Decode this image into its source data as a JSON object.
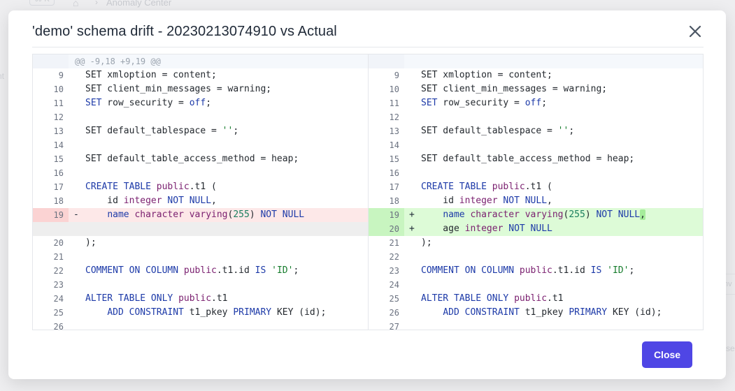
{
  "background": {
    "tag": "⌘ K",
    "breadcrumb": "Anomaly Center",
    "side_text": "nt",
    "right_box_text": "nv",
    "right_text": "se"
  },
  "modal": {
    "title": "'demo' schema drift - 20230213074910 vs Actual",
    "close_label": "Close",
    "hunk_header": "@@ -9,18 +9,19 @@",
    "colors": {
      "accent": "#4f46e5",
      "deleted": "#fde8e8",
      "added": "#ddfbd7",
      "keyword": "#1d3aa8"
    }
  },
  "diff": {
    "left": [
      {
        "num": "9",
        "type": "ctx",
        "tokens": [
          [
            "",
            "SET xmloption = content;"
          ]
        ]
      },
      {
        "num": "10",
        "type": "ctx",
        "tokens": [
          [
            "",
            "SET client_min_messages = warning;"
          ]
        ]
      },
      {
        "num": "11",
        "type": "ctx",
        "tokens": [
          [
            "k",
            "SET"
          ],
          [
            "",
            " row_security = "
          ],
          [
            "k",
            "off"
          ],
          [
            "",
            ";"
          ]
        ]
      },
      {
        "num": "12",
        "type": "ctx",
        "tokens": []
      },
      {
        "num": "13",
        "type": "ctx",
        "tokens": [
          [
            "",
            "SET default_tablespace = "
          ],
          [
            "s",
            "''"
          ],
          [
            "",
            ";"
          ]
        ]
      },
      {
        "num": "14",
        "type": "ctx",
        "tokens": []
      },
      {
        "num": "15",
        "type": "ctx",
        "tokens": [
          [
            "",
            "SET default_table_access_method = heap;"
          ]
        ]
      },
      {
        "num": "16",
        "type": "ctx",
        "tokens": []
      },
      {
        "num": "17",
        "type": "ctx",
        "tokens": [
          [
            "k",
            "CREATE TABLE "
          ],
          [
            "t",
            "public"
          ],
          [
            "",
            ".t1 ("
          ]
        ]
      },
      {
        "num": "18",
        "type": "ctx",
        "tokens": [
          [
            "",
            "    id "
          ],
          [
            "t",
            "integer"
          ],
          [
            "k",
            " NOT NULL"
          ],
          [
            "",
            ","
          ]
        ]
      },
      {
        "num": "19",
        "type": "del",
        "marker": "-",
        "tokens": [
          [
            "",
            "    "
          ],
          [
            "k",
            "name"
          ],
          [
            "",
            " "
          ],
          [
            "t",
            "character varying"
          ],
          [
            "",
            "("
          ],
          [
            "n",
            "255"
          ],
          [
            "",
            ") "
          ],
          [
            "k",
            "NOT NULL"
          ]
        ]
      },
      {
        "num": "",
        "type": "empty",
        "tokens": []
      },
      {
        "num": "20",
        "type": "ctx",
        "tokens": [
          [
            "",
            ");"
          ]
        ]
      },
      {
        "num": "21",
        "type": "ctx",
        "tokens": []
      },
      {
        "num": "22",
        "type": "ctx",
        "tokens": [
          [
            "k",
            "COMMENT ON COLUMN "
          ],
          [
            "t",
            "public"
          ],
          [
            "",
            ".t1.id "
          ],
          [
            "k",
            "IS"
          ],
          [
            "",
            " "
          ],
          [
            "s",
            "'ID'"
          ],
          [
            "",
            ";"
          ]
        ]
      },
      {
        "num": "23",
        "type": "ctx",
        "tokens": []
      },
      {
        "num": "24",
        "type": "ctx",
        "tokens": [
          [
            "k",
            "ALTER TABLE ONLY "
          ],
          [
            "t",
            "public"
          ],
          [
            "",
            ".t1"
          ]
        ]
      },
      {
        "num": "25",
        "type": "ctx",
        "tokens": [
          [
            "",
            "    "
          ],
          [
            "k",
            "ADD CONSTRAINT"
          ],
          [
            "",
            " t1_pkey "
          ],
          [
            "k",
            "PRIMARY"
          ],
          [
            "",
            " KEY (id);"
          ]
        ]
      },
      {
        "num": "26",
        "type": "ctx",
        "tokens": []
      }
    ],
    "right": [
      {
        "num": "9",
        "type": "ctx",
        "tokens": [
          [
            "",
            "SET xmloption = content;"
          ]
        ]
      },
      {
        "num": "10",
        "type": "ctx",
        "tokens": [
          [
            "",
            "SET client_min_messages = warning;"
          ]
        ]
      },
      {
        "num": "11",
        "type": "ctx",
        "tokens": [
          [
            "k",
            "SET"
          ],
          [
            "",
            " row_security = "
          ],
          [
            "k",
            "off"
          ],
          [
            "",
            ";"
          ]
        ]
      },
      {
        "num": "12",
        "type": "ctx",
        "tokens": []
      },
      {
        "num": "13",
        "type": "ctx",
        "tokens": [
          [
            "",
            "SET default_tablespace = "
          ],
          [
            "s",
            "''"
          ],
          [
            "",
            ";"
          ]
        ]
      },
      {
        "num": "14",
        "type": "ctx",
        "tokens": []
      },
      {
        "num": "15",
        "type": "ctx",
        "tokens": [
          [
            "",
            "SET default_table_access_method = heap;"
          ]
        ]
      },
      {
        "num": "16",
        "type": "ctx",
        "tokens": []
      },
      {
        "num": "17",
        "type": "ctx",
        "tokens": [
          [
            "k",
            "CREATE TABLE "
          ],
          [
            "t",
            "public"
          ],
          [
            "",
            ".t1 ("
          ]
        ]
      },
      {
        "num": "18",
        "type": "ctx",
        "tokens": [
          [
            "",
            "    id "
          ],
          [
            "t",
            "integer"
          ],
          [
            "k",
            " NOT NULL"
          ],
          [
            "",
            ","
          ]
        ]
      },
      {
        "num": "19",
        "type": "add",
        "marker": "+",
        "tokens": [
          [
            "",
            "    "
          ],
          [
            "k",
            "name"
          ],
          [
            "",
            " "
          ],
          [
            "t",
            "character varying"
          ],
          [
            "",
            "("
          ],
          [
            "n",
            "255"
          ],
          [
            "",
            ") "
          ],
          [
            "k",
            "NOT NULL"
          ],
          [
            "hl",
            ","
          ]
        ]
      },
      {
        "num": "20",
        "type": "add",
        "marker": "+",
        "tokens": [
          [
            "",
            "    age "
          ],
          [
            "t",
            "integer"
          ],
          [
            "k",
            " NOT NULL"
          ]
        ]
      },
      {
        "num": "21",
        "type": "ctx",
        "tokens": [
          [
            "",
            ");"
          ]
        ]
      },
      {
        "num": "22",
        "type": "ctx",
        "tokens": []
      },
      {
        "num": "23",
        "type": "ctx",
        "tokens": [
          [
            "k",
            "COMMENT ON COLUMN "
          ],
          [
            "t",
            "public"
          ],
          [
            "",
            ".t1.id "
          ],
          [
            "k",
            "IS"
          ],
          [
            "",
            " "
          ],
          [
            "s",
            "'ID'"
          ],
          [
            "",
            ";"
          ]
        ]
      },
      {
        "num": "24",
        "type": "ctx",
        "tokens": []
      },
      {
        "num": "25",
        "type": "ctx",
        "tokens": [
          [
            "k",
            "ALTER TABLE ONLY "
          ],
          [
            "t",
            "public"
          ],
          [
            "",
            ".t1"
          ]
        ]
      },
      {
        "num": "26",
        "type": "ctx",
        "tokens": [
          [
            "",
            "    "
          ],
          [
            "k",
            "ADD CONSTRAINT"
          ],
          [
            "",
            " t1_pkey "
          ],
          [
            "k",
            "PRIMARY"
          ],
          [
            "",
            " KEY (id);"
          ]
        ]
      },
      {
        "num": "27",
        "type": "ctx",
        "tokens": []
      }
    ]
  }
}
